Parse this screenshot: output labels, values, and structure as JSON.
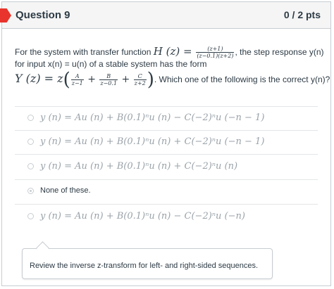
{
  "question": {
    "title": "Question 9",
    "points": "0 / 2 pts",
    "text_line1_a": "For the system with transfer function ",
    "hz_label": "H (z) = ",
    "hz_num": "(z+1)",
    "hz_den": "(z−0.1)(z+2)",
    "text_line1_b": ", the step response y(n)",
    "text_line2": "for input x(n) = u(n) of a stable system has the form",
    "yz_label": "Y (z) = z",
    "f1_num": "A",
    "f1_den": "z−1",
    "f2_num": "B",
    "f2_den": "z−0.1",
    "f3_num": "C",
    "f3_den": "z+2",
    "text_line3": ". Which one of the following is the correct y(n)?"
  },
  "options": [
    {
      "text": "y (n) = Au (n) + B(0.1)ⁿu (n) − C(−2)ⁿu (−n − 1)",
      "selected": false
    },
    {
      "text": "y (n) = Au (n) + B(0.1)ⁿu (n) + C(−2)ⁿu (−n − 1)",
      "selected": false
    },
    {
      "text": "y (n) = Au (n) + B(0.1)ⁿu (n) + C(−2)ⁿu (n)",
      "selected": false
    },
    {
      "text": "None of these.",
      "selected": true
    },
    {
      "text": "y (n) = Au (n) + B(0.1)ⁿu (n) − C(−2)ⁿu (−n)",
      "selected": false
    }
  ],
  "feedback": "Review the inverse z-transform for left- and right-sided sequences.",
  "colors": {
    "flag": "#e8342c",
    "header_bg": "#f5f5f5",
    "border": "#c7cdd1"
  }
}
